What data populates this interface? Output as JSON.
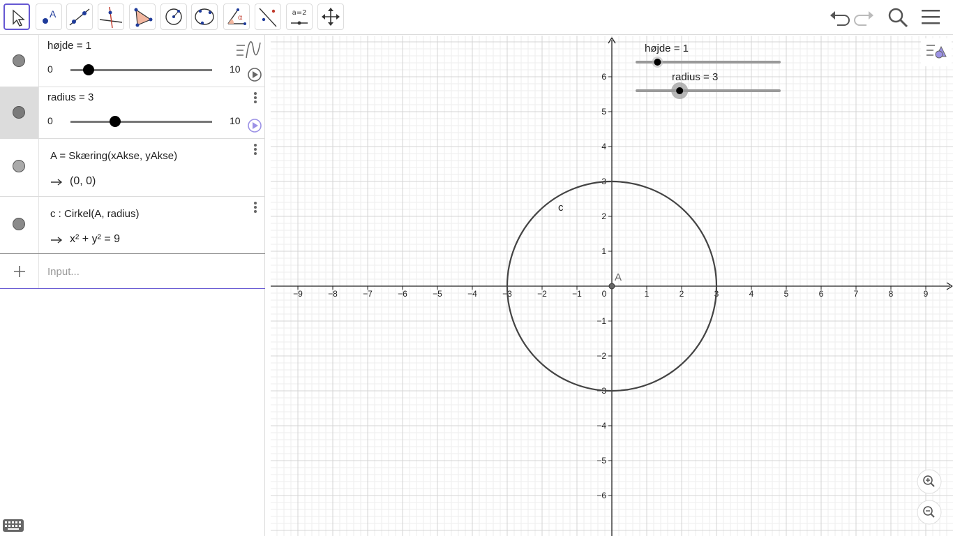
{
  "toolbar": {
    "tools": [
      {
        "name": "move-tool"
      },
      {
        "name": "point-tool",
        "letter": "A"
      },
      {
        "name": "line-tool"
      },
      {
        "name": "perpendicular-tool"
      },
      {
        "name": "polygon-tool"
      },
      {
        "name": "circle-center-tool"
      },
      {
        "name": "conic-tool"
      },
      {
        "name": "angle-tool",
        "letter": "α"
      },
      {
        "name": "reflect-tool"
      },
      {
        "name": "slider-tool",
        "label": "a=2"
      },
      {
        "name": "move-view-tool"
      }
    ]
  },
  "algebra": {
    "slider_hojde": {
      "label": "højde = 1",
      "min": "0",
      "max": "10",
      "value": 1
    },
    "slider_radius": {
      "label": "radius = 3",
      "min": "0",
      "max": "10",
      "value": 3
    },
    "point_A": {
      "definition": "A = Skæring(xAkse, yAkse)",
      "value": "(0,  0)"
    },
    "circle_c": {
      "definition": "c : Cirkel(A, radius)",
      "value": "x² + y² = 9"
    },
    "input_placeholder": "Input..."
  },
  "graphics": {
    "slider_hojde_label": "højde = 1",
    "slider_radius_label": "radius = 3",
    "point_label": "A",
    "circle_label": "c",
    "x_ticks": [
      "−9",
      "−8",
      "−7",
      "−6",
      "−5",
      "−4",
      "−3",
      "−2",
      "−1",
      "0",
      "1",
      "2",
      "3",
      "4",
      "5",
      "6",
      "7",
      "8",
      "9"
    ],
    "y_ticks_pos": [
      "1",
      "2",
      "3",
      "4",
      "5",
      "6"
    ],
    "y_ticks_neg": [
      "−1",
      "−2",
      "−3",
      "−4",
      "−5",
      "−6"
    ],
    "circle_radius": 3,
    "slider_hojde_value": 1,
    "slider_radius_value": 3
  },
  "colors": {
    "accent": "#6557d2",
    "curve": "#444444"
  }
}
